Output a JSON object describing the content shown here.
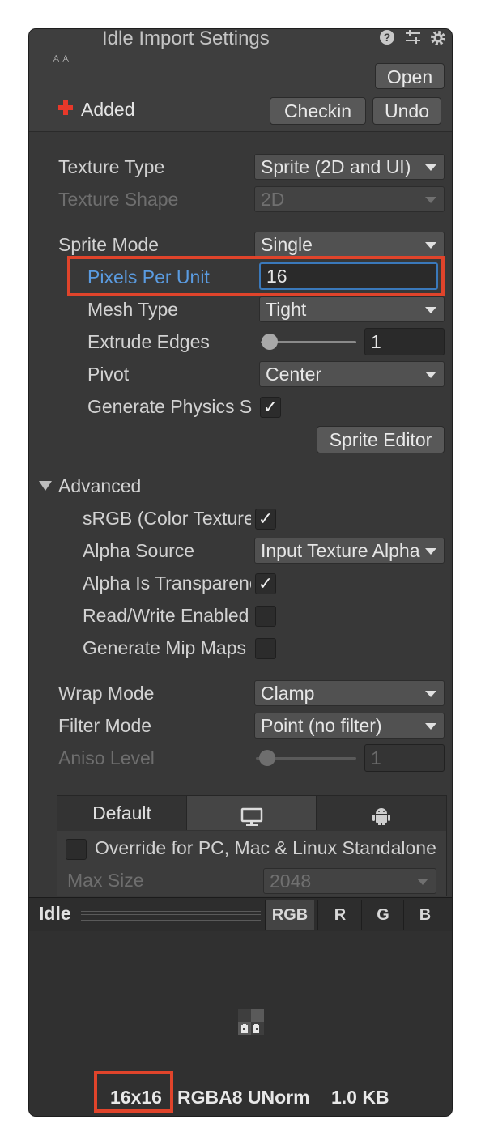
{
  "header": {
    "title": "Idle Import Settings",
    "asset_icon": "♙♙",
    "icons": [
      "help-icon",
      "preset-icon",
      "settings-gear-icon"
    ],
    "open_label": "Open",
    "vcs_status": "Added",
    "checkin_label": "Checkin",
    "undo_label": "Undo"
  },
  "texture": {
    "type_label": "Texture Type",
    "type_value": "Sprite (2D and UI)",
    "shape_label": "Texture Shape",
    "shape_value": "2D"
  },
  "sprite": {
    "mode_label": "Sprite Mode",
    "mode_value": "Single",
    "ppu_label": "Pixels Per Unit",
    "ppu_value": "16",
    "mesh_label": "Mesh Type",
    "mesh_value": "Tight",
    "extrude_label": "Extrude Edges",
    "extrude_value": "1",
    "pivot_label": "Pivot",
    "pivot_value": "Center",
    "physics_label": "Generate Physics Shape",
    "physics_checked": true,
    "editor_button": "Sprite Editor"
  },
  "advanced": {
    "header": "Advanced",
    "srgb_label": "sRGB (Color Texture)",
    "srgb_checked": true,
    "alpha_source_label": "Alpha Source",
    "alpha_source_value": "Input Texture Alpha",
    "alpha_transparency_label": "Alpha Is Transparency",
    "alpha_transparency_checked": true,
    "readwrite_label": "Read/Write Enabled",
    "readwrite_checked": false,
    "mipmap_label": "Generate Mip Maps",
    "mipmap_checked": false
  },
  "sampling": {
    "wrap_label": "Wrap Mode",
    "wrap_value": "Clamp",
    "filter_label": "Filter Mode",
    "filter_value": "Point (no filter)",
    "aniso_label": "Aniso Level",
    "aniso_value": "1"
  },
  "platforms": {
    "tabs": [
      "Default",
      "monitor-icon",
      "android-icon"
    ],
    "default_label": "Default",
    "override_label": "Override for PC, Mac & Linux Standalone",
    "override_checked": false,
    "max_size_label": "Max Size",
    "max_size_value": "2048"
  },
  "preview": {
    "name": "Idle",
    "channels": [
      "RGB",
      "R",
      "G",
      "B"
    ],
    "dimensions": "16x16",
    "format": "RGBA8 UNorm",
    "size": "1.0 KB"
  },
  "colors": {
    "accent_label": "#5a9be0",
    "highlight": "#e0442b",
    "panel_bg": "#383838",
    "vcs_added": "#e8382a"
  }
}
